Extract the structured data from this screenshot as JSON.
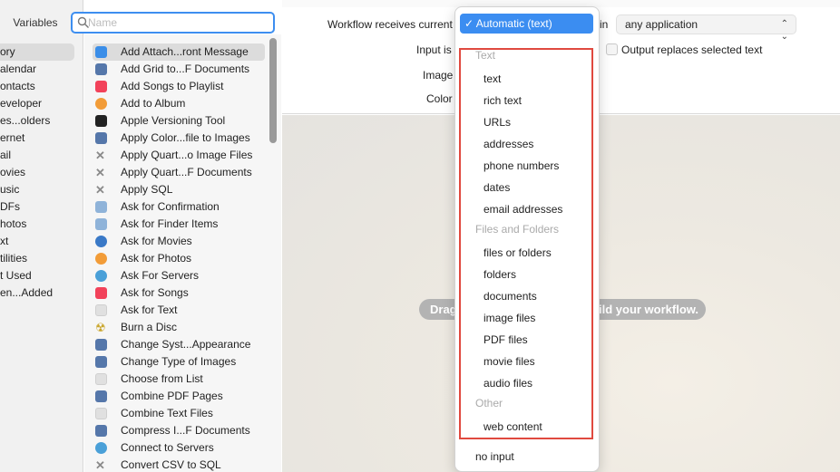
{
  "library": {
    "tab_variables": "Variables",
    "search_placeholder": "Name",
    "categories": [
      "ory",
      "alendar",
      "ontacts",
      "eveloper",
      "es...olders",
      "ernet",
      "ail",
      "ovies",
      "usic",
      "DFs",
      "hotos",
      "xt",
      "tilities",
      "t Used",
      "en...Added"
    ],
    "selected_category_index": 0
  },
  "actions": {
    "items": [
      {
        "label": "Add Attach...ront Message",
        "icon": "mail-icon",
        "color": "#3b8ee8"
      },
      {
        "label": "Add Grid to...F Documents",
        "icon": "automator-icon",
        "color": "#5577aa"
      },
      {
        "label": "Add Songs to Playlist",
        "icon": "music-icon",
        "color": "#f2425a"
      },
      {
        "label": "Add to Album",
        "icon": "photos-icon",
        "color": "#f29c38"
      },
      {
        "label": "Apple Versioning Tool",
        "icon": "terminal-icon",
        "color": "#222222"
      },
      {
        "label": "Apply Color...file to Images",
        "icon": "automator-icon",
        "color": "#5577aa"
      },
      {
        "label": "Apply Quart...o Image Files",
        "icon": "tools-icon",
        "color": "#8a8a8a"
      },
      {
        "label": "Apply Quart...F Documents",
        "icon": "tools-icon",
        "color": "#8a8a8a"
      },
      {
        "label": "Apply SQL",
        "icon": "tools-icon",
        "color": "#8a8a8a"
      },
      {
        "label": "Ask for Confirmation",
        "icon": "finder-icon",
        "color": "#8fb3d9"
      },
      {
        "label": "Ask for Finder Items",
        "icon": "finder-icon",
        "color": "#8fb3d9"
      },
      {
        "label": "Ask for Movies",
        "icon": "quicktime-icon",
        "color": "#3a79c7"
      },
      {
        "label": "Ask for Photos",
        "icon": "photos-icon",
        "color": "#f29c38"
      },
      {
        "label": "Ask For Servers",
        "icon": "network-icon",
        "color": "#4aa0d8"
      },
      {
        "label": "Ask for Songs",
        "icon": "music-icon",
        "color": "#f2425a"
      },
      {
        "label": "Ask for Text",
        "icon": "document-icon",
        "color": "#e0e0e0"
      },
      {
        "label": "Burn a Disc",
        "icon": "burn-icon",
        "color": "#c9a52a"
      },
      {
        "label": "Change Syst...Appearance",
        "icon": "automator-icon",
        "color": "#5577aa"
      },
      {
        "label": "Change Type of Images",
        "icon": "automator-icon",
        "color": "#5577aa"
      },
      {
        "label": "Choose from List",
        "icon": "document-icon",
        "color": "#e0e0e0"
      },
      {
        "label": "Combine PDF Pages",
        "icon": "automator-icon",
        "color": "#5577aa"
      },
      {
        "label": "Combine Text Files",
        "icon": "document-icon",
        "color": "#e0e0e0"
      },
      {
        "label": "Compress I...F Documents",
        "icon": "automator-icon",
        "color": "#5577aa"
      },
      {
        "label": "Connect to Servers",
        "icon": "network-icon",
        "color": "#4aa0d8"
      },
      {
        "label": "Convert CSV to SQL",
        "icon": "tools-icon",
        "color": "#8a8a8a"
      }
    ],
    "selected_index": 0
  },
  "properties": {
    "receives_label": "Workflow receives current",
    "in_label": "in",
    "app_select_value": "any application",
    "input_is_label": "Input is",
    "image_label": "Image",
    "color_label": "Color",
    "output_replaces_label": "Output replaces selected text"
  },
  "canvas": {
    "hint_left": "Drag",
    "hint_right": "ild your workflow."
  },
  "menu": {
    "selected": "✓ Automatic (text)",
    "sections": [
      {
        "header": "Text",
        "items": [
          "text",
          "rich text",
          "URLs",
          "addresses",
          "phone numbers",
          "dates",
          "email addresses"
        ]
      },
      {
        "header": "Files and Folders",
        "items": [
          "files or folders",
          "folders",
          "documents",
          "image files",
          "PDF files",
          "movie files",
          "audio files"
        ]
      },
      {
        "header": "Other",
        "items": [
          "web content"
        ]
      }
    ],
    "no_input": "no input"
  },
  "colors": {
    "accent": "#3b8df1",
    "highlight_border": "#e0493f",
    "menu_header": "#aaaaaa"
  }
}
